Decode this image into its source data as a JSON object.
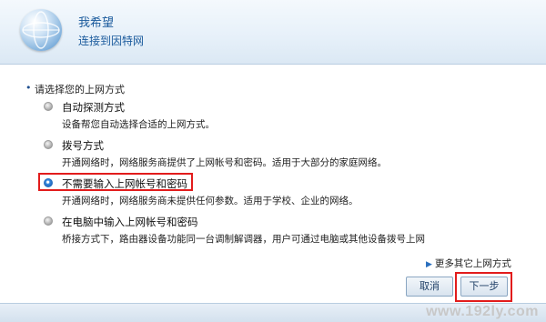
{
  "header": {
    "title": "我希望",
    "subtitle": "连接到因特网"
  },
  "prompt": "请选择您的上网方式",
  "options": [
    {
      "title": "自动探测方式",
      "desc": "设备帮您自动选择合适的上网方式。",
      "selected": false
    },
    {
      "title": "拨号方式",
      "desc": "开通网络时，网络服务商提供了上网帐号和密码。适用于大部分的家庭网络。",
      "selected": false
    },
    {
      "title": "不需要输入上网帐号和密码",
      "desc": "开通网络时，网络服务商未提供任何参数。适用于学校、企业的网络。",
      "selected": true
    },
    {
      "title": "在电脑中输入上网帐号和密码",
      "desc": "桥接方式下，路由器设备功能同一台调制解调器，用户可通过电脑或其他设备拨号上网",
      "selected": false
    }
  ],
  "more_link": "更多其它上网方式",
  "buttons": {
    "cancel": "取消",
    "next": "下一步"
  },
  "watermark": "www.192ly.com"
}
